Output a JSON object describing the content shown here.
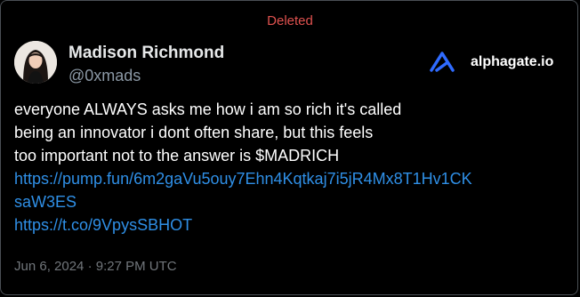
{
  "status": "Deleted",
  "author": {
    "name": "Madison Richmond",
    "handle": "@0xmads"
  },
  "brand": {
    "name": "alphagate.io",
    "logo_icon": "alphagate-logo-icon",
    "logo_color": "#2f6bff"
  },
  "tweet": {
    "lines": [
      "everyone ALWAYS asks me how i am so rich it's called",
      "being an innovator i dont often share, but this feels",
      "too important not to the answer is $MADRICH"
    ],
    "links": [
      "https://pump.fun/6m2gaVu5ouy7Ehn4Kqtkaj7i5jR4Mx8T1Hv1CK",
      "saW3ES",
      "https://t.co/9VpysSBHOT"
    ]
  },
  "timestamp": "Jun 6, 2024 · 9:27 PM UTC",
  "colors": {
    "deleted": "#e0524f",
    "link": "#2f8fe6",
    "muted": "#71767b"
  }
}
